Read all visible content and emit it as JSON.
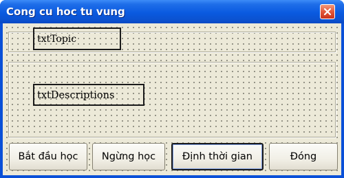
{
  "window": {
    "title": "Cong cu hoc tu vung",
    "close_icon": "close-icon"
  },
  "form": {
    "topic_field": "txtTopic",
    "description_field": "txtDescriptions"
  },
  "buttons": {
    "start": "Bắt đầu học",
    "stop": "Ngừng học",
    "timer": "Định thời gian",
    "close": "Đóng"
  },
  "colors": {
    "titlebar": "#0a5ae0",
    "client_background": "#ece9d8",
    "close_button": "#e2573a"
  }
}
